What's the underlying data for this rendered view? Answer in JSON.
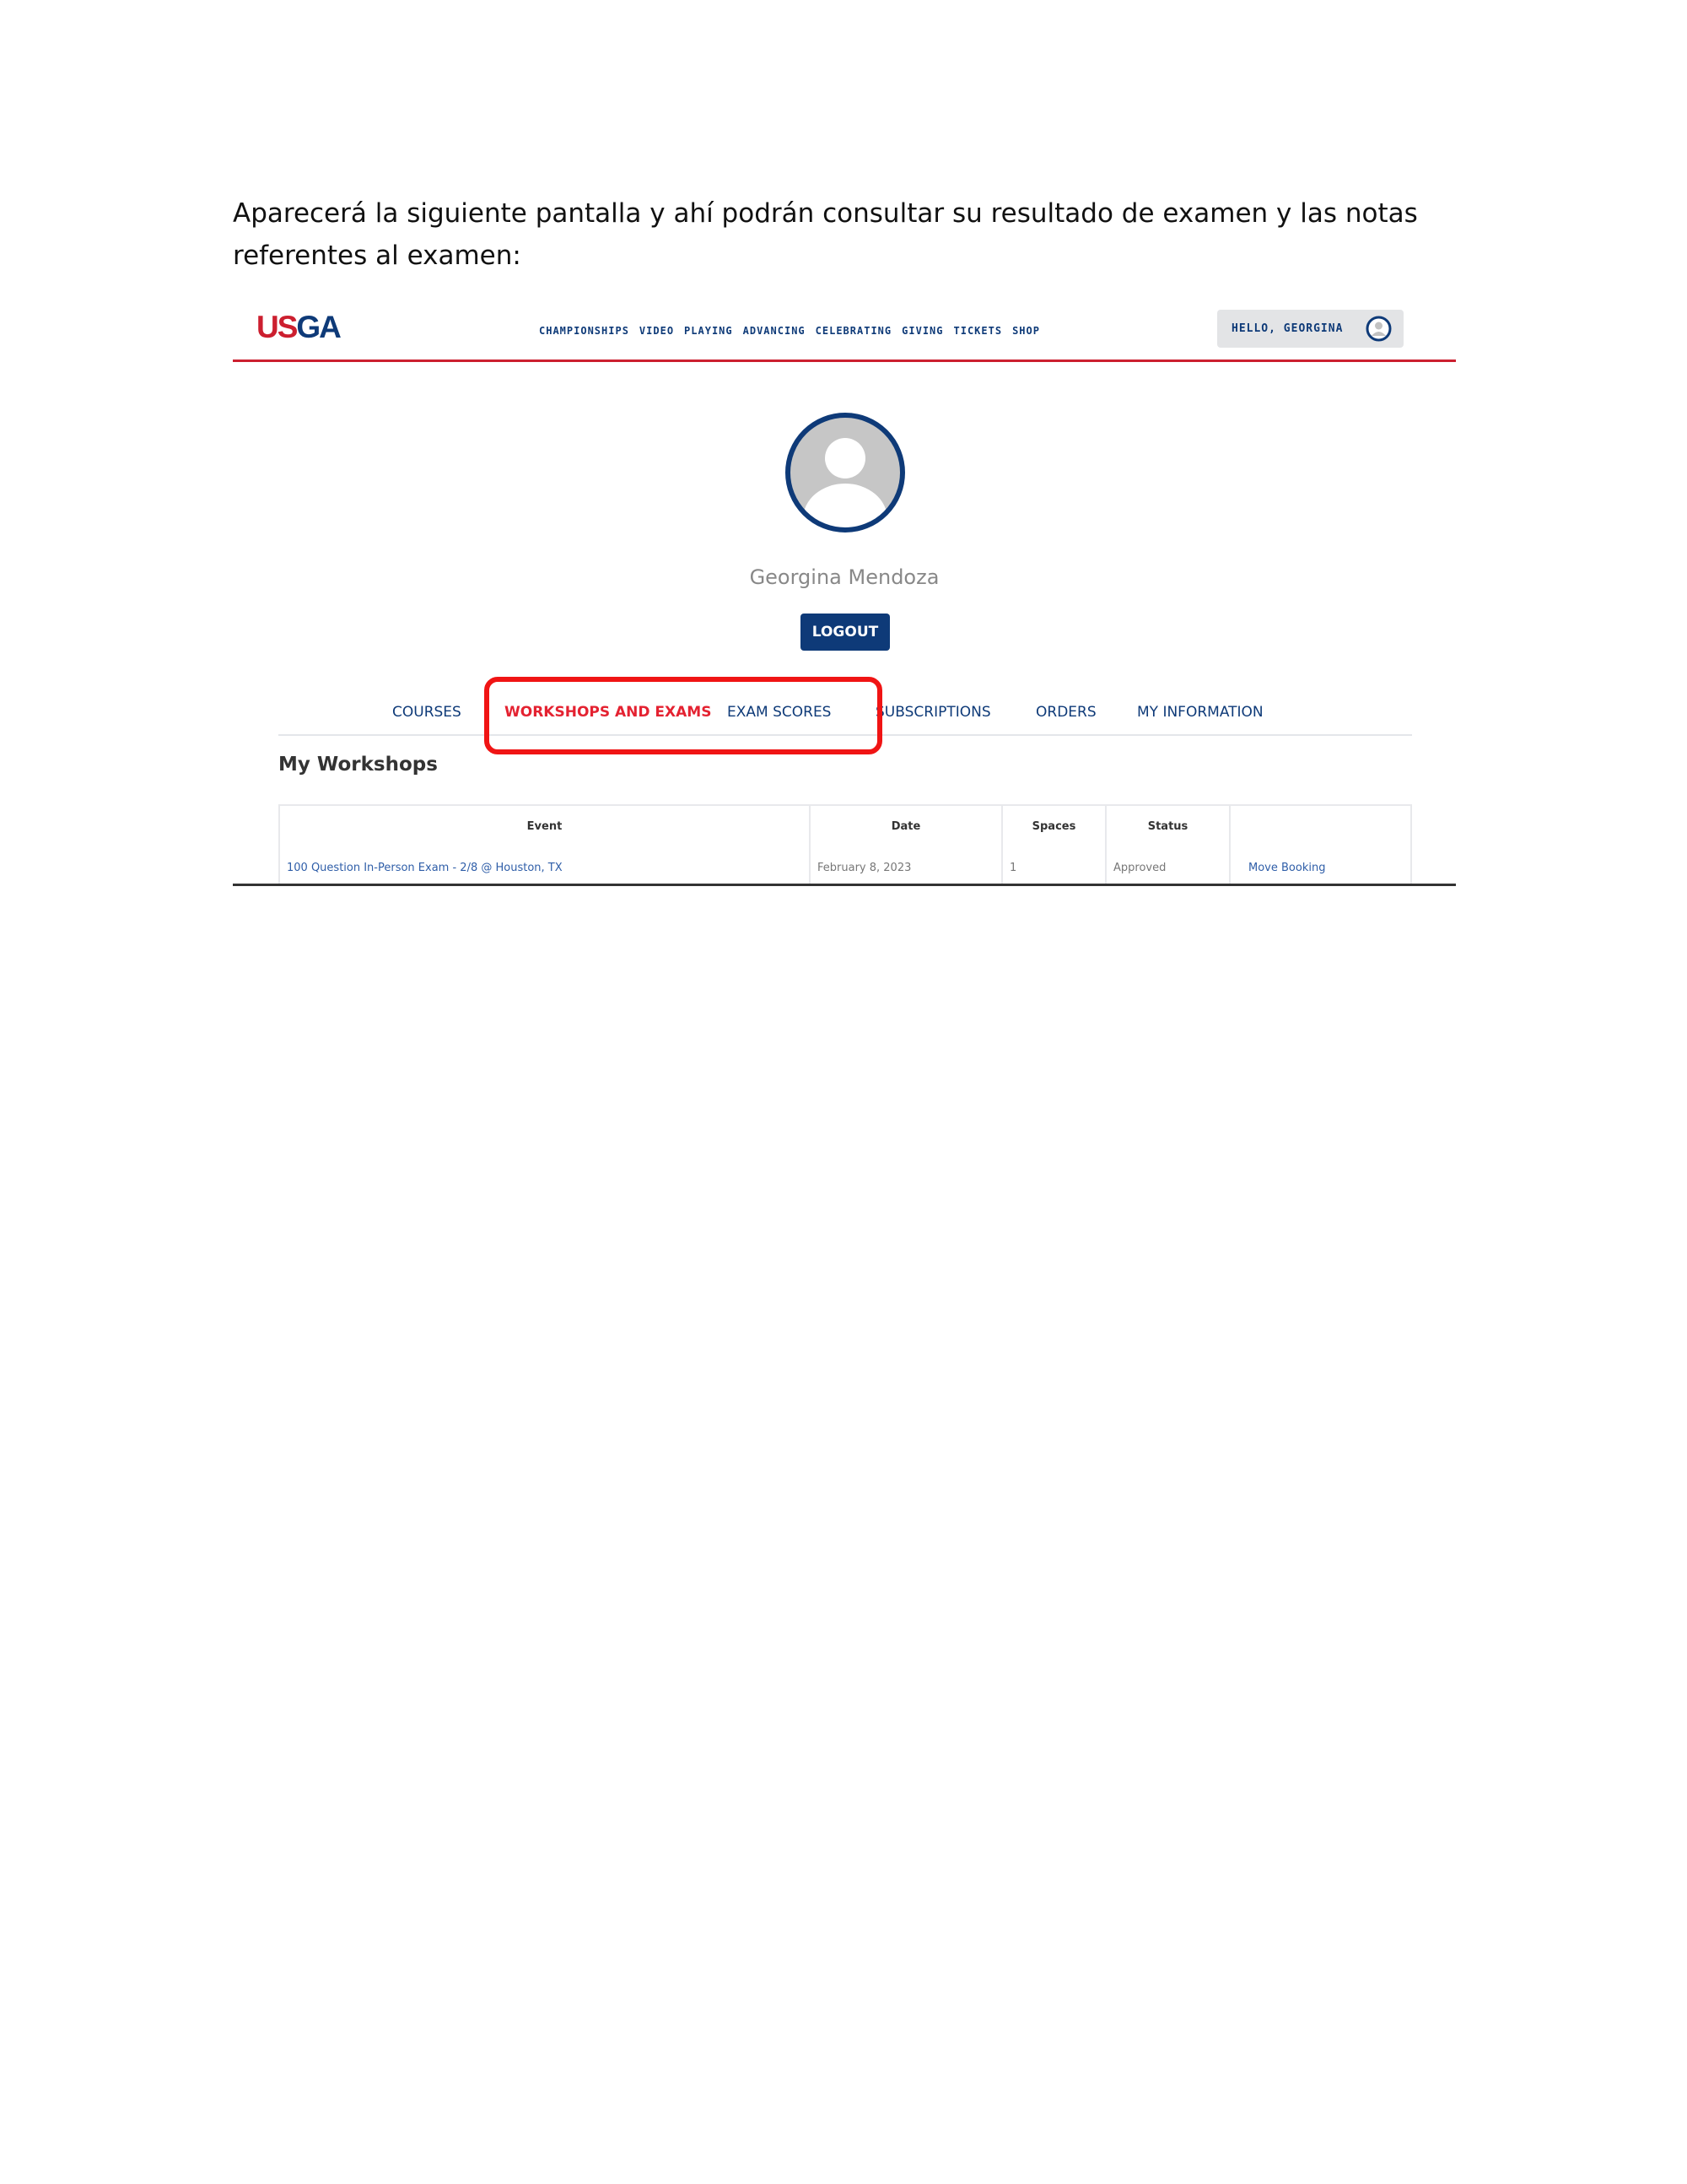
{
  "document": {
    "intro_line1": "Aparecerá la siguiente pantalla y ahí podrán consultar su resultado de examen y las notas",
    "intro_line2": "referentes al examen:"
  },
  "header": {
    "logo_us": "US",
    "logo_ga": "GA",
    "nav": [
      "CHAMPIONSHIPS",
      "VIDEO",
      "PLAYING",
      "ADVANCING",
      "CELEBRATING",
      "GIVING",
      "TICKETS",
      "SHOP"
    ],
    "greeting": "HELLO, GEORGINA"
  },
  "profile": {
    "name": "Georgina Mendoza",
    "logout_label": "LOGOUT"
  },
  "tabs": [
    {
      "label": "COURSES",
      "active": false
    },
    {
      "label": "WORKSHOPS AND EXAMS",
      "active": true
    },
    {
      "label": "EXAM SCORES",
      "active": false
    },
    {
      "label": "SUBSCRIPTIONS",
      "active": false
    },
    {
      "label": "ORDERS",
      "active": false
    },
    {
      "label": "MY INFORMATION",
      "active": false
    }
  ],
  "workshops": {
    "title": "My Workshops",
    "columns": [
      "Event",
      "Date",
      "Spaces",
      "Status",
      ""
    ],
    "rows": [
      {
        "event": "100 Question In-Person Exam - 2/8 @ Houston, TX",
        "date": "February 8, 2023",
        "spaces": "1",
        "status": "Approved",
        "action": "Move Booking"
      }
    ]
  },
  "colors": {
    "usga_red": "#cc1f2f",
    "usga_navy": "#0e3a78",
    "highlight_red": "#f01414"
  }
}
